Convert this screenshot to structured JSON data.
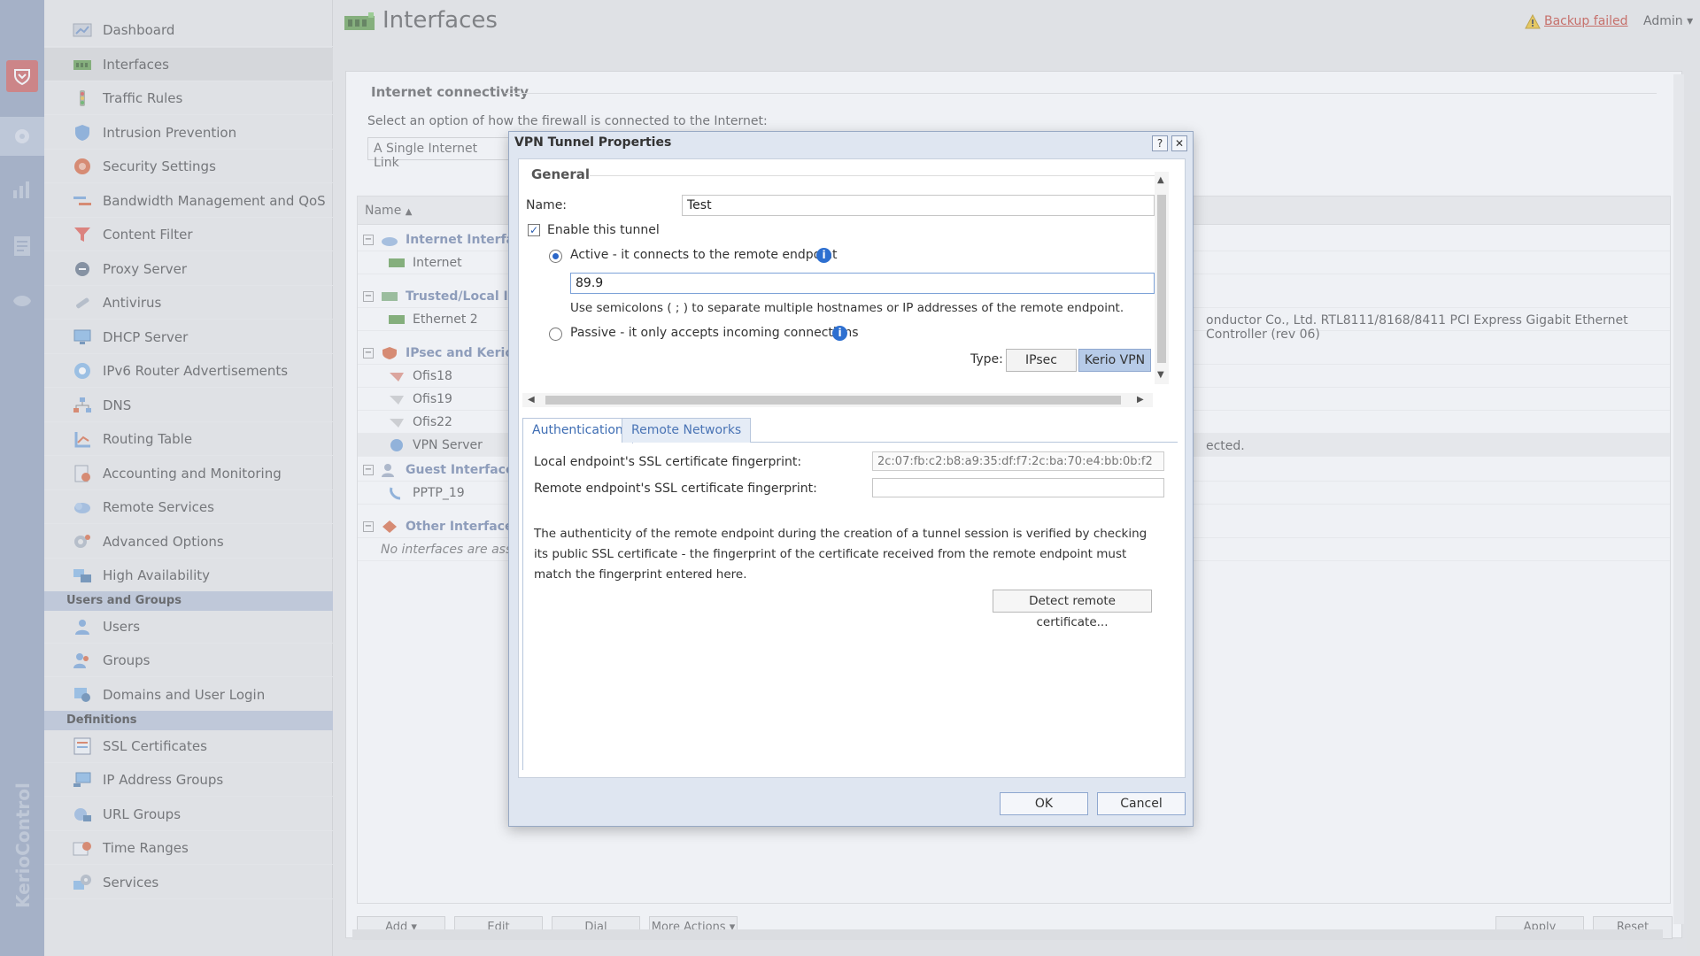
{
  "header": {
    "title": "Interfaces",
    "backup_status": "Backup failed",
    "user_menu": "Admin"
  },
  "rail": {
    "brand": "KerioControl"
  },
  "sidebar": {
    "items": [
      {
        "label": "Dashboard",
        "icon": "dashboard-icon"
      },
      {
        "label": "Interfaces",
        "icon": "interfaces-icon"
      },
      {
        "label": "Traffic Rules",
        "icon": "traffic-rules-icon"
      },
      {
        "label": "Intrusion Prevention",
        "icon": "shield-icon"
      },
      {
        "label": "Security Settings",
        "icon": "security-icon"
      },
      {
        "label": "Bandwidth Management and QoS",
        "icon": "bandwidth-icon"
      },
      {
        "label": "Content Filter",
        "icon": "filter-icon"
      },
      {
        "label": "Proxy Server",
        "icon": "proxy-icon"
      },
      {
        "label": "Antivirus",
        "icon": "antivirus-icon"
      },
      {
        "label": "DHCP Server",
        "icon": "dhcp-icon"
      },
      {
        "label": "IPv6 Router Advertisements",
        "icon": "ipv6-icon"
      },
      {
        "label": "DNS",
        "icon": "dns-icon"
      },
      {
        "label": "Routing Table",
        "icon": "routing-icon"
      },
      {
        "label": "Accounting and Monitoring",
        "icon": "accounting-icon"
      },
      {
        "label": "Remote Services",
        "icon": "remote-services-icon"
      },
      {
        "label": "Advanced Options",
        "icon": "advanced-options-icon"
      },
      {
        "label": "High Availability",
        "icon": "high-availability-icon"
      }
    ],
    "section_users": "Users and Groups",
    "users_items": [
      {
        "label": "Users",
        "icon": "user-icon"
      },
      {
        "label": "Groups",
        "icon": "groups-icon"
      },
      {
        "label": "Domains and User Login",
        "icon": "domains-icon"
      }
    ],
    "section_definitions": "Definitions",
    "definitions_items": [
      {
        "label": "SSL Certificates",
        "icon": "certificate-icon"
      },
      {
        "label": "IP Address Groups",
        "icon": "ip-groups-icon"
      },
      {
        "label": "URL Groups",
        "icon": "url-groups-icon"
      },
      {
        "label": "Time Ranges",
        "icon": "time-ranges-icon"
      },
      {
        "label": "Services",
        "icon": "services-icon"
      }
    ]
  },
  "main": {
    "section_title": "Internet connectivity",
    "connect_text": "Select an option of how the firewall is connected to the Internet:",
    "connect_option": "A Single Internet Link",
    "grid_header_name": "Name",
    "rows": [
      {
        "label": "Internet Interfac",
        "kind": "group"
      },
      {
        "label": "Internet",
        "kind": "item"
      },
      {
        "label": "Trusted/Local Int",
        "kind": "group"
      },
      {
        "label": "Ethernet 2",
        "kind": "item"
      },
      {
        "label": "IPsec and Kerio V",
        "kind": "group"
      },
      {
        "label": "Ofis18",
        "kind": "item"
      },
      {
        "label": "Ofis19",
        "kind": "item"
      },
      {
        "label": "Ofis22",
        "kind": "item"
      },
      {
        "label": "VPN Server",
        "kind": "item"
      },
      {
        "label": "Guest Interfaces",
        "kind": "group"
      },
      {
        "label": "PPTP_19",
        "kind": "item"
      },
      {
        "label": "Other Interfaces",
        "kind": "group"
      },
      {
        "label": "No interfaces are assig",
        "kind": "empty"
      }
    ],
    "ethernet_detail": "onductor Co., Ltd. RTL8111/8168/8411 PCI Express Gigabit Ethernet Controller (rev 06)",
    "vpn_detail": "ected.",
    "toolbar": {
      "add": "Add",
      "edit": "Edit",
      "dial": "Dial",
      "more": "More Actions",
      "apply": "Apply",
      "reset": "Reset"
    }
  },
  "dialog": {
    "title": "VPN Tunnel Properties",
    "help_btn": "?",
    "close_btn": "✕",
    "general_label": "General",
    "name_label": "Name:",
    "name_value": "Test",
    "enable_label": "Enable this tunnel",
    "active_label": "Active - it connects to the remote endpoint",
    "endpoint_value": "89.9",
    "hint": "Use semicolons ( ; ) to separate multiple hostnames or IP addresses of the remote endpoint.",
    "passive_label": "Passive - it only accepts incoming connections",
    "type_label": "Type:",
    "type_ipsec": "IPsec",
    "type_kerio": "Kerio VPN",
    "tab_auth": "Authentication",
    "tab_networks": "Remote Networks",
    "local_fp_label": "Local endpoint's SSL certificate fingerprint:",
    "local_fp_value": "2c:07:fb:c2:b8:a9:35:df:f7:2c:ba:70:e4:bb:0b:f2",
    "remote_fp_label": "Remote endpoint's SSL certificate fingerprint:",
    "remote_fp_value": "",
    "auth_paragraph": "The authenticity of the remote endpoint during the creation of a tunnel session is verified by checking its public SSL certificate - the fingerprint of the certificate received from the remote endpoint must match the fingerprint entered here.",
    "detect_btn": "Detect remote certificate...",
    "ok": "OK",
    "cancel": "Cancel"
  }
}
